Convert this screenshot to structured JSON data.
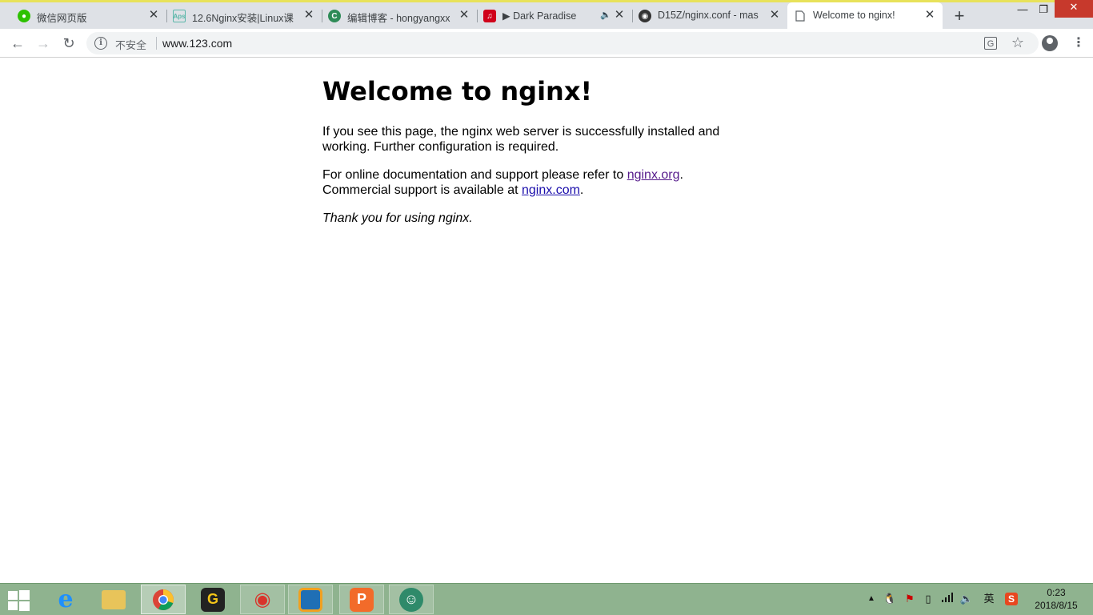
{
  "browser": {
    "tabs": [
      {
        "title": "微信网页版",
        "icon": "wechat-icon",
        "color": "#2dc100"
      },
      {
        "title": "12.6Nginx安装|Linux课",
        "icon": "aps-icon",
        "color": "#5bb7a9"
      },
      {
        "title": "编辑博客 - hongyangxx",
        "icon": "blog-c-icon",
        "color": "#2e8b57"
      },
      {
        "title": "▶ Dark Paradise",
        "icon": "netease-music-icon",
        "color": "#d0021b"
      },
      {
        "title": "D15Z/nginx.conf - mas",
        "icon": "github-icon",
        "color": "#333333"
      },
      {
        "title": "Welcome to nginx!",
        "icon": "page-icon",
        "color": "#5f6368"
      }
    ],
    "security_label": "不安全",
    "url": "www.123.com"
  },
  "page": {
    "heading": "Welcome to nginx!",
    "para1": "If you see this page, the nginx web server is successfully installed and working. Further configuration is required.",
    "para2_prefix": "For online documentation and support please refer to ",
    "link1": "nginx.org",
    "para2_mid": ".",
    "para2_line2_prefix": "Commercial support is available at ",
    "link2": "nginx.com",
    "para2_suffix": ".",
    "thanks": "Thank you for using nginx."
  },
  "taskbar": {
    "ime_label": "英",
    "time": "0:23",
    "date": "2018/8/15"
  },
  "colors": {
    "taskbar": "#8fb38f",
    "tab_strip": "#dee1e6",
    "link": "#1a0dab",
    "link_visited": "#551a8b"
  }
}
